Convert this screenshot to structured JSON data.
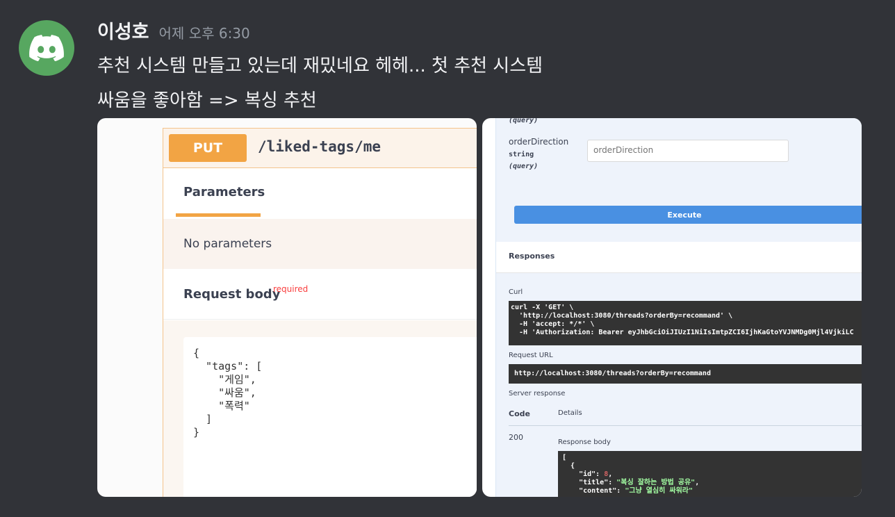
{
  "message": {
    "author": "이성호",
    "timestamp": "어제 오후 6:30",
    "line1": "추천 시스템 만들고 있는데 재밌네요 헤헤... 첫 추천 시스템",
    "line2": "싸움을 좋아함 => 복싱 추천"
  },
  "left_screenshot": {
    "method": "PUT",
    "path": "/liked-tags/me",
    "tab_label": "Parameters",
    "no_params": "No parameters",
    "request_body_label": "Request body",
    "required_label": "required",
    "code": "{\n  \"tags\": [\n    \"게임\",\n    \"싸움\",\n    \"폭력\"\n  ]\n}"
  },
  "right_screenshot": {
    "query_top": "(query)",
    "param_name": "orderDirection",
    "param_type": "string",
    "param_in": "(query)",
    "input_placeholder": "orderDirection",
    "execute_label": "Execute",
    "responses_label": "Responses",
    "curl_label": "Curl",
    "curl_text": "curl -X 'GET' \\\n  'http://localhost:3080/threads?orderBy=recommand' \\\n  -H 'accept: */*' \\\n  -H 'Authorization: Bearer eyJhbGciOiJIUzI1NiIsImtpZCI6IjhKaGtoYVJNMDg0Mjl4VjkiLC",
    "request_url_label": "Request URL",
    "request_url": "http://localhost:3080/threads?orderBy=recommand",
    "server_response_label": "Server response",
    "code_header": "Code",
    "details_header": "Details",
    "status_code": "200",
    "response_body_label": "Response body",
    "response_bracket_open": "[",
    "response_obj_open": "  {",
    "response_id_key": "    \"id\": ",
    "response_id_val": "8",
    "response_title_key": "    \"title\": ",
    "response_title_val": "\"복싱 잘하는 방법 공유\"",
    "response_content_key": "    \"content\": ",
    "response_content_val": "\"그냥 열심히 싸워라\""
  },
  "colors": {
    "background": "#313338",
    "avatar": "#57a760",
    "put_badge": "#f2a444",
    "execute": "#4990e2"
  }
}
